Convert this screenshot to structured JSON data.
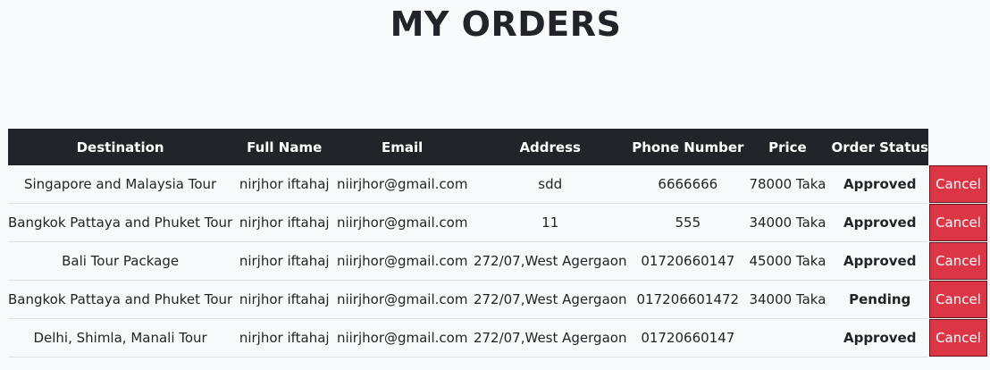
{
  "page": {
    "title": "MY ORDERS"
  },
  "table": {
    "headers": [
      "Destination",
      "Full Name",
      "Email",
      "Address",
      "Phone Number",
      "Price",
      "Order Status"
    ],
    "rows": [
      {
        "destination": "Singapore and Malaysia Tour",
        "name": "nirjhor iftahaj",
        "email": "niirjhor@gmail.com",
        "address": "sdd",
        "phone": "6666666",
        "price": "78000 Taka",
        "status": "Approved",
        "action": "Cancel"
      },
      {
        "destination": "Bangkok Pattaya and Phuket Tour",
        "name": "nirjhor iftahaj",
        "email": "niirjhor@gmail.com",
        "address": "11",
        "phone": "555",
        "price": "34000 Taka",
        "status": "Approved",
        "action": "Cancel"
      },
      {
        "destination": "Bali Tour Package",
        "name": "nirjhor iftahaj",
        "email": "niirjhor@gmail.com",
        "address": "272/07,West Agergaon",
        "phone": "01720660147",
        "price": "45000 Taka",
        "status": "Approved",
        "action": "Cancel"
      },
      {
        "destination": "Bangkok Pattaya and Phuket Tour",
        "name": "nirjhor iftahaj",
        "email": "niirjhor@gmail.com",
        "address": "272/07,West Agergaon",
        "phone": "017206601472",
        "price": "34000 Taka",
        "status": "Pending",
        "action": "Cancel"
      },
      {
        "destination": "Delhi, Shimla, Manali Tour",
        "name": "nirjhor iftahaj",
        "email": "niirjhor@gmail.com",
        "address": "272/07,West Agergaon",
        "phone": "01720660147",
        "price": "",
        "status": "Approved",
        "action": "Cancel"
      }
    ]
  },
  "colors": {
    "header_bg": "#212529",
    "cancel_button": "#dc3545",
    "page_bg": "#f8f9fa"
  }
}
